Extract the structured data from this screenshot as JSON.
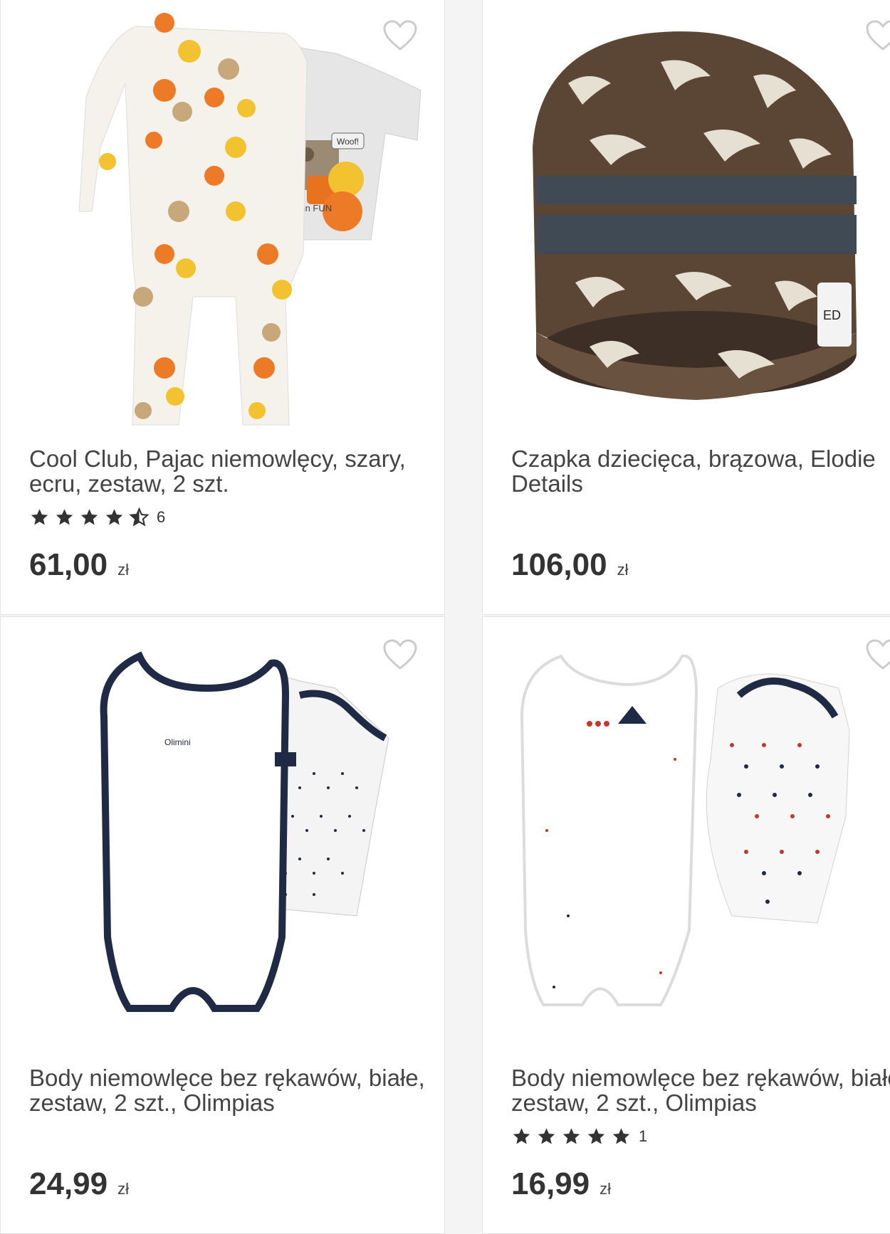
{
  "products": [
    {
      "title": "Cool Club, Pajac niemowlęcy, szary, ecru, zestaw, 2 szt.",
      "rating": 4.5,
      "rating_count": "6",
      "price": "61,00",
      "currency": "zł",
      "image_alt": "Pajac niemowlęcy w dynie",
      "image_text_1": "Autumn FUN",
      "image_text_2": "Woof!"
    },
    {
      "title": "Czapka dziecięca, brązowa, Elodie Details",
      "price": "106,00",
      "currency": "zł",
      "image_alt": "Brązowa czapka w tygrysy",
      "image_text_1": "ED"
    },
    {
      "title": "Body niemowlęce bez rękawów, białe, zestaw, 2 szt., Olimpias",
      "price": "24,99",
      "currency": "zł",
      "image_alt": "Białe body z granatowym wykończeniem"
    },
    {
      "title": "Body niemowlęce bez rękawów, białe, zestaw, 2 szt., Olimpias",
      "rating": 5,
      "rating_count": "1",
      "price": "16,99",
      "currency": "zł",
      "image_alt": "Białe body w kropki"
    }
  ],
  "colors": {
    "background": "#f4f4f4",
    "card": "#ffffff",
    "text": "#333333",
    "heart_outline": "#cccccc",
    "star": "#333333"
  },
  "icons": {
    "favorite": "heart-outline-icon",
    "rating": "star-icon"
  }
}
